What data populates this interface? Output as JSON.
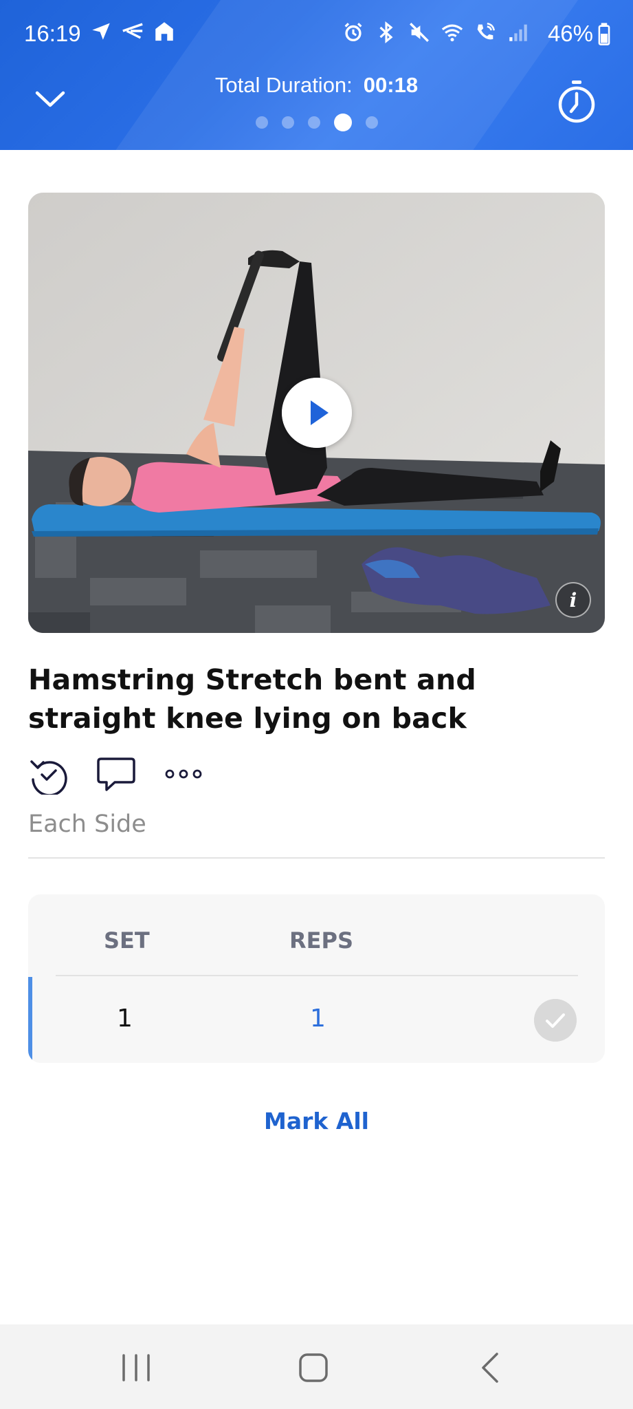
{
  "status_bar": {
    "time": "16:19",
    "battery": "46%",
    "icons_left": [
      "send-icon",
      "fitness-app-icon",
      "home-icon"
    ],
    "icons_right": [
      "alarm-icon",
      "bluetooth-icon",
      "mute-icon",
      "wifi-icon",
      "wifi-call-icon",
      "signal-icon",
      "battery-icon"
    ]
  },
  "header": {
    "duration_label": "Total Duration:",
    "duration_value": "00:18",
    "page_count": 5,
    "active_page": 4,
    "background": "#2a6ee6"
  },
  "exercise": {
    "title": "Hamstring Stretch bent and straight knee lying on back",
    "subtitle": "Each Side",
    "video": {
      "play_icon": "play-icon",
      "info_label": "i"
    },
    "actions": [
      "history-check-icon",
      "comment-icon",
      "more-icon"
    ]
  },
  "sets_table": {
    "headers": {
      "set": "SET",
      "reps": "REPS"
    },
    "rows": [
      {
        "set": "1",
        "reps": "1",
        "completed": false
      }
    ]
  },
  "mark_all_label": "Mark All",
  "nav_bar": [
    "recents-button",
    "home-button",
    "back-button"
  ],
  "colors": {
    "accent": "#1f63cf",
    "reps": "#2d6fdc",
    "row_accent": "#4e8fe6"
  }
}
